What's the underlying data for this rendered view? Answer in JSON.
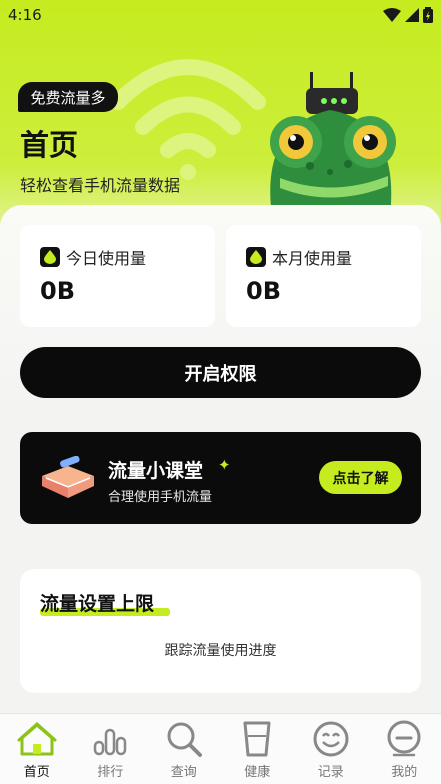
{
  "status_bar": {
    "time": "4:16"
  },
  "header": {
    "pill": "免费流量多",
    "title": "首页",
    "subtitle": "轻松查看手机流量数据"
  },
  "stats": {
    "today": {
      "label": "今日使用量",
      "value": "0B"
    },
    "month": {
      "label": "本月使用量",
      "value": "0B"
    }
  },
  "permission_button": "开启权限",
  "classroom": {
    "title": "流量小课堂",
    "subtitle": "合理使用手机流量",
    "button": "点击了解"
  },
  "limit_card": {
    "title": "流量设置上限",
    "description": "跟踪流量使用进度"
  },
  "tabs": [
    {
      "label": "首页",
      "icon": "home-icon",
      "active": true
    },
    {
      "label": "排行",
      "icon": "bar-chart-icon",
      "active": false
    },
    {
      "label": "查询",
      "icon": "search-icon",
      "active": false
    },
    {
      "label": "健康",
      "icon": "cup-icon",
      "active": false
    },
    {
      "label": "记录",
      "icon": "smile-icon",
      "active": false
    },
    {
      "label": "我的",
      "icon": "profile-icon",
      "active": false
    }
  ],
  "colors": {
    "accent": "#c5ec1f",
    "dark": "#0b0b0b"
  }
}
